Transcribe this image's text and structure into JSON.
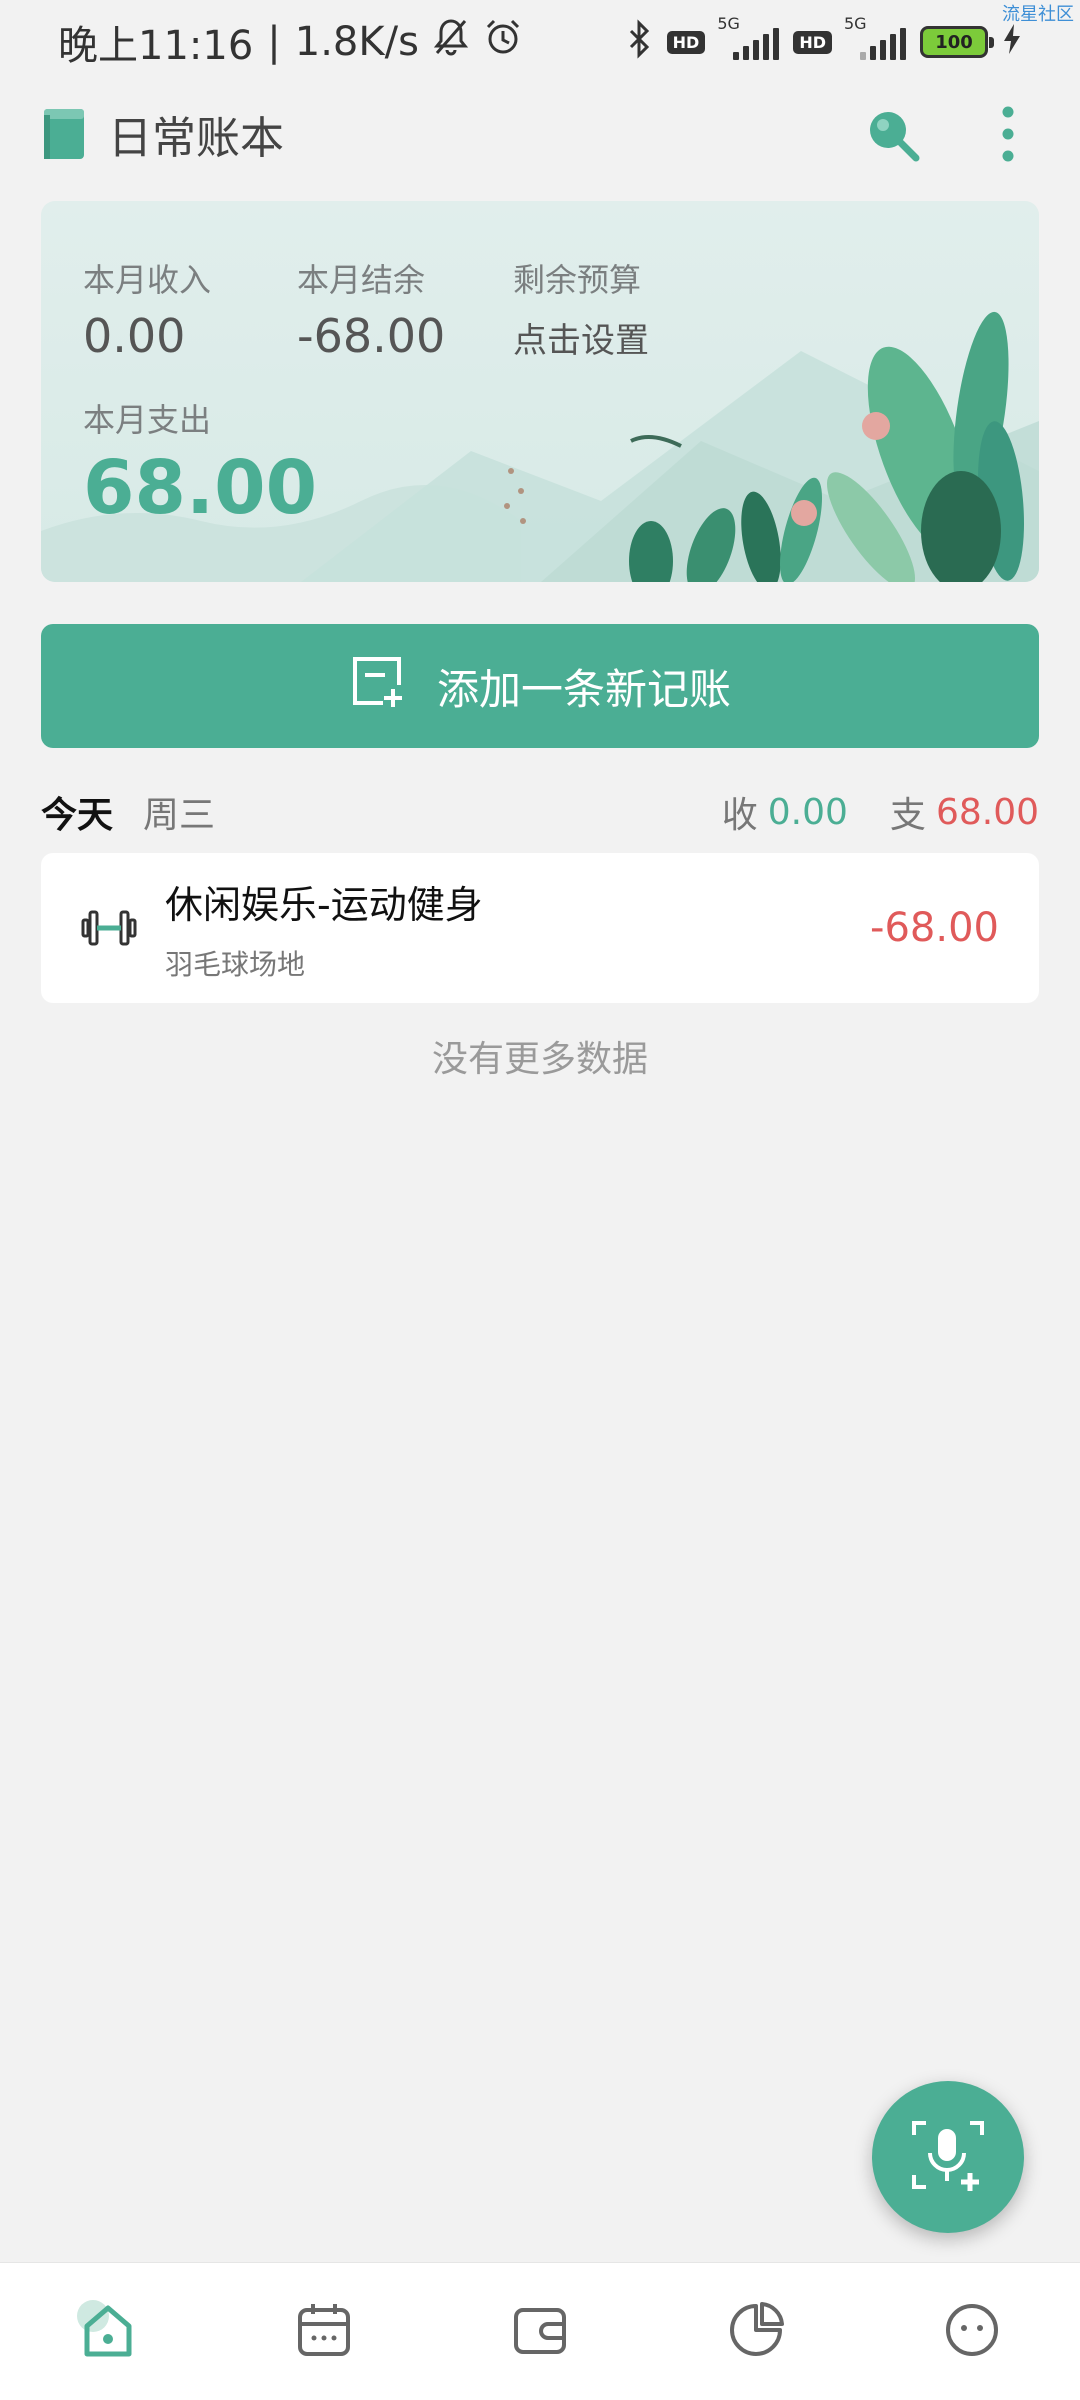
{
  "status_bar": {
    "time": "晚上11:16",
    "network_speed": "1.8K/s",
    "signal_label_1": "5G",
    "signal_label_2": "5G",
    "hd_label": "HD",
    "battery": "100",
    "watermark": "流星社区"
  },
  "app_bar": {
    "title": "日常账本",
    "icons": [
      "book-icon",
      "search-icon",
      "more-vertical-icon"
    ]
  },
  "summary": {
    "income_label": "本月收入",
    "income_value": "0.00",
    "balance_label": "本月结余",
    "balance_value": "-68.00",
    "budget_label": "剩余预算",
    "budget_value": "点击设置",
    "expense_label": "本月支出",
    "expense_value": "68.00"
  },
  "add_button": {
    "label": "添加一条新记账",
    "icon": "add-note-icon"
  },
  "day": {
    "today": "今天",
    "weekday": "周三",
    "income_label": "收",
    "income_value": "0.00",
    "expense_label": "支",
    "expense_value": "68.00"
  },
  "records": [
    {
      "icon": "dumbbell-icon",
      "category": "休闲娱乐-运动健身",
      "note": "羽毛球场地",
      "amount": "-68.00"
    }
  ],
  "no_more": "没有更多数据",
  "fab_icon": "voice-add-icon",
  "bottom_nav": [
    "home-icon",
    "calendar-icon",
    "wallet-icon",
    "pie-chart-icon",
    "profile-icon"
  ],
  "colors": {
    "accent": "#4bae94",
    "expense": "#e05a5a",
    "background": "#f2f2f2"
  }
}
